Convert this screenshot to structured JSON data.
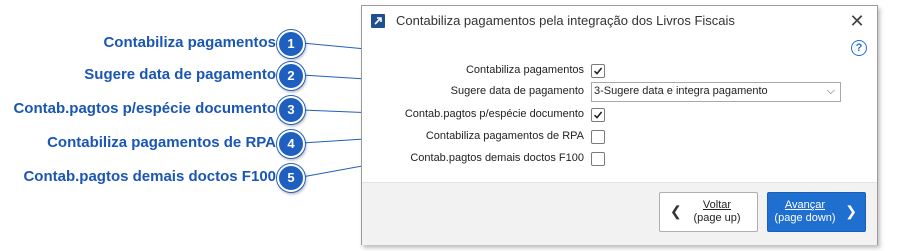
{
  "callouts": [
    {
      "number": "1",
      "label": "Contabiliza pagamentos"
    },
    {
      "number": "2",
      "label": "Sugere data de pagamento"
    },
    {
      "number": "3",
      "label": "Contab.pagtos p/espécie documento"
    },
    {
      "number": "4",
      "label": "Contabiliza pagamentos de RPA"
    },
    {
      "number": "5",
      "label": "Contab.pagtos demais doctos F100"
    }
  ],
  "dialog": {
    "title": "Contabiliza pagamentos pela integração dos Livros Fiscais",
    "close_icon": "close-icon",
    "help_icon": "help-icon",
    "help_glyph": "?",
    "fields": {
      "contabiliza_pagamentos": {
        "label": "Contabiliza pagamentos",
        "checked": true
      },
      "sugere_data": {
        "label": "Sugere data de pagamento",
        "value": "3-Sugere data e integra pagamento"
      },
      "especie_documento": {
        "label": "Contab.pagtos p/espécie documento",
        "checked": true
      },
      "rpa": {
        "label": "Contabiliza pagamentos de RPA",
        "checked": false
      },
      "demais_doctos": {
        "label": "Contab.pagtos demais doctos F100",
        "checked": false
      }
    },
    "buttons": {
      "back": {
        "label": "Voltar",
        "hint": "(page up)"
      },
      "next": {
        "label": "Avançar",
        "hint": "(page down)"
      }
    }
  },
  "colors": {
    "callout_text": "#1a56b4",
    "badge": "#1f5fbf",
    "primary_button": "#1f6fd1"
  }
}
